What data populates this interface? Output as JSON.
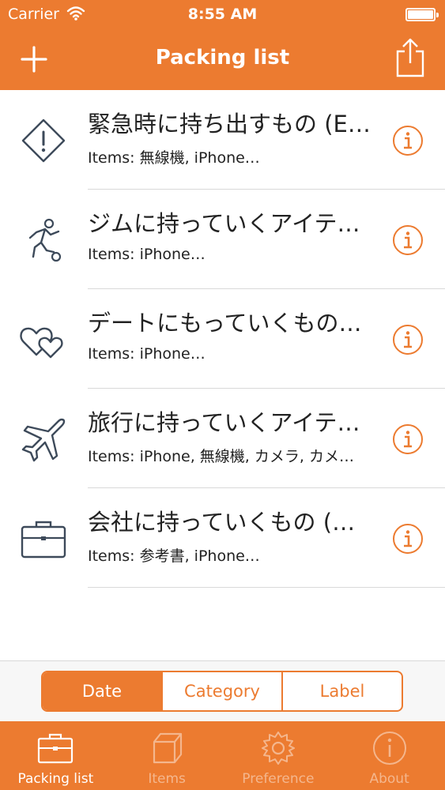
{
  "status_bar": {
    "carrier": "Carrier",
    "time": "8:55 AM"
  },
  "nav": {
    "title": "Packing list",
    "left_icon": "plus-icon",
    "right_icon": "share-icon"
  },
  "lists": [
    {
      "title": "緊急時に持ち出すもの (E…",
      "items": "Items: 無線機, iPhone…",
      "icon": "warning-diamond-icon"
    },
    {
      "title": "ジムに持っていくアイテ…",
      "items": "Items: iPhone…",
      "icon": "soccer-player-icon"
    },
    {
      "title": "デートにもっていくもの…",
      "items": "Items: iPhone…",
      "icon": "hearts-icon"
    },
    {
      "title": "旅行に持っていくアイテ…",
      "items": "Items: iPhone, 無線機, カメラ, カメ…",
      "icon": "airplane-icon"
    },
    {
      "title": "会社に持っていくもの (…",
      "items": "Items: 参考書, iPhone…",
      "icon": "briefcase-icon"
    }
  ],
  "sort": {
    "options": [
      "Date",
      "Category",
      "Label"
    ],
    "selected": "Date"
  },
  "tabs": [
    {
      "label": "Packing list",
      "icon": "briefcase-icon",
      "active": true
    },
    {
      "label": "Items",
      "icon": "box-icon",
      "active": false
    },
    {
      "label": "Preference",
      "icon": "gear-icon",
      "active": false
    },
    {
      "label": "About",
      "icon": "info-icon",
      "active": false
    }
  ],
  "colors": {
    "accent": "#ec7b30",
    "text": "#222222",
    "separator": "#d9d9d9",
    "icon_stroke": "#3d4a5a"
  }
}
